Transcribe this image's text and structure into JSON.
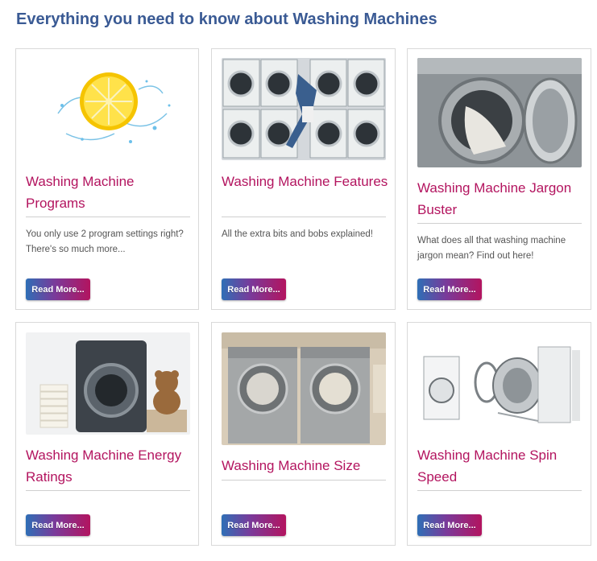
{
  "page": {
    "title": "Everything you need to know about Washing Machines"
  },
  "cards": [
    {
      "title": "Washing Machine Programs",
      "description": "You only use 2 program settings right? There's so much more...",
      "button": "Read More..."
    },
    {
      "title": "Washing Machine Features",
      "description": "All the extra bits and bobs explained!",
      "button": "Read More..."
    },
    {
      "title": "Washing Machine Jargon Buster",
      "description": "What does all that washing machine jargon mean? Find out here!",
      "button": "Read More..."
    },
    {
      "title": "Washing Machine Energy Ratings",
      "description": "",
      "button": "Read More..."
    },
    {
      "title": "Washing Machine Size",
      "description": "",
      "button": "Read More..."
    },
    {
      "title": "Washing Machine Spin Speed",
      "description": "",
      "button": "Read More..."
    }
  ],
  "colors": {
    "title": "#3a5a94",
    "card_title": "#b3145f",
    "button_gradient_start": "#2f6fb6",
    "button_gradient_end": "#b3145f"
  }
}
